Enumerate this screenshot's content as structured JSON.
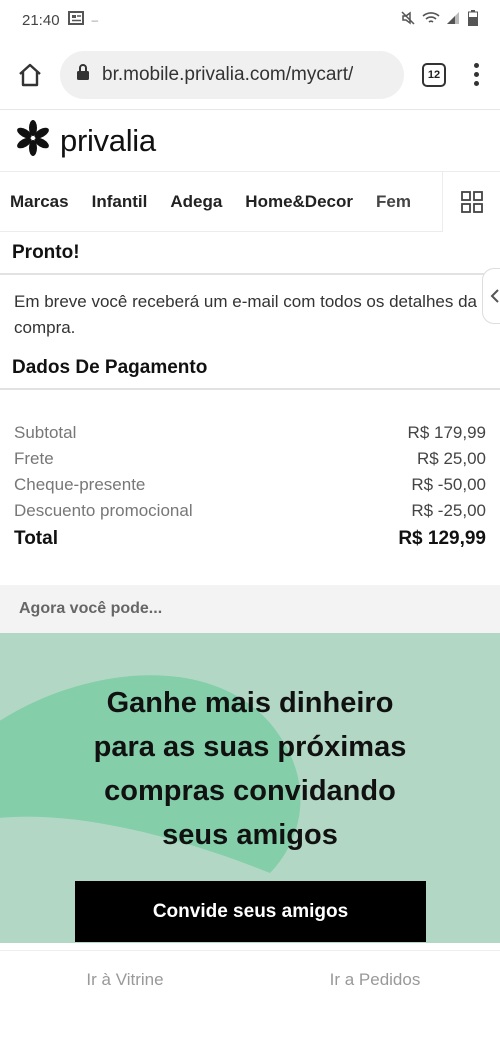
{
  "status_bar": {
    "time": "21:40",
    "dash": "–"
  },
  "browser": {
    "url": "br.mobile.privalia.com/mycart/",
    "tab_count": "12"
  },
  "logo": {
    "text": "privalia"
  },
  "categories": [
    "Marcas",
    "Infantil",
    "Adega",
    "Home&Decor",
    "Fem"
  ],
  "confirmation": {
    "title": "Pronto!",
    "message": "Em breve você receberá um e-mail com todos os detalhes da compra."
  },
  "payment": {
    "title": "Dados De Pagamento",
    "rows": [
      {
        "label": "Subtotal",
        "value": "R$ 179,99"
      },
      {
        "label": "Frete",
        "value": "R$ 25,00"
      },
      {
        "label": "Cheque-presente",
        "value": "R$ -50,00"
      },
      {
        "label": "Descuento promocional",
        "value": "R$ -25,00"
      }
    ],
    "total_label": "Total",
    "total_value": "R$ 129,99"
  },
  "agora": {
    "label": "Agora você pode..."
  },
  "promo": {
    "line1": "Ganhe mais dinheiro",
    "line2": "para as suas próximas",
    "line3": "compras convidando",
    "line4": "seus amigos",
    "button": "Convide seus amigos",
    "accent_color": "#7ecda6",
    "background_color": "#b2d8c5"
  },
  "footer": {
    "vitrine": "Ir à Vitrine",
    "pedidos": "Ir a Pedidos"
  }
}
